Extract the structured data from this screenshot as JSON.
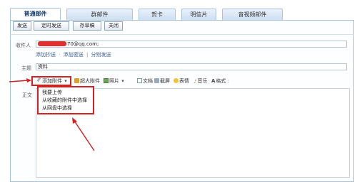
{
  "tabs": [
    "普通邮件",
    "群邮件",
    "贺卡",
    "明信片",
    "音视频邮件"
  ],
  "actions": {
    "send": "发送",
    "schedule": "定时发送",
    "draft": "存草稿",
    "close": "关闭"
  },
  "recipient": {
    "label": "收件人",
    "value": "70@qq.com;",
    "links": [
      "添加抄送",
      "添加密送",
      "分别发送"
    ],
    "link_separator_1": "·",
    "link_separator_2": "|"
  },
  "subject": {
    "label": "主题",
    "value": "资料"
  },
  "toolbar": {
    "attach": "添加附件",
    "big_attach": "超大附件",
    "photo": "照片",
    "doc": "文档",
    "screenshot": "截屏",
    "emoji": "表情",
    "music": "音乐",
    "format": "格式"
  },
  "body_label": "正文",
  "attach_menu": [
    "我要上传",
    "从收藏的附件中选择",
    "从网盘中选择"
  ],
  "colors": {
    "highlight": "#d42020",
    "tab_active_text": "#1b3d6d",
    "link": "#3b5f8f"
  }
}
